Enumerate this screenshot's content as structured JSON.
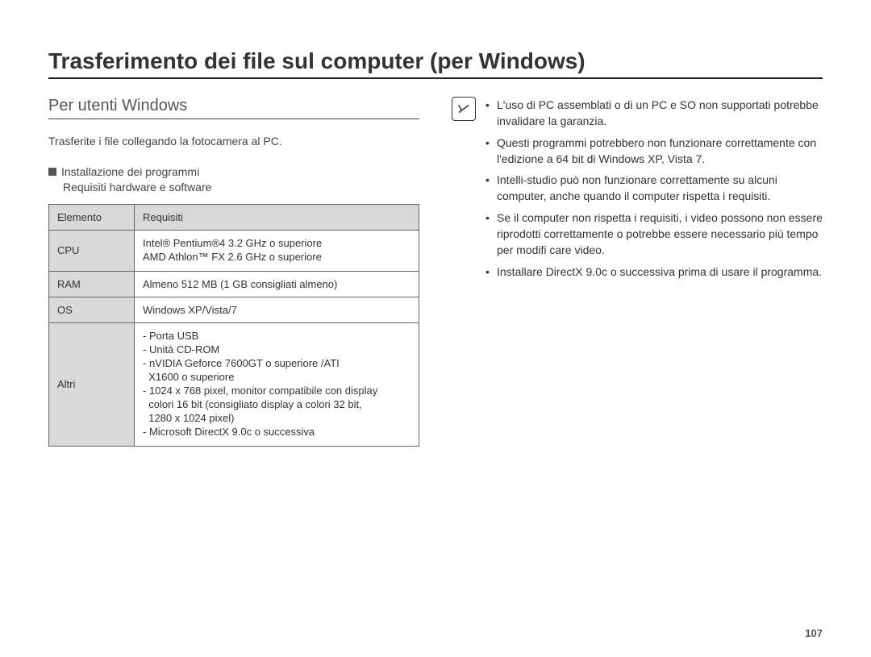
{
  "page_number": "107",
  "title": "Trasferimento dei file sul computer (per Windows)",
  "left": {
    "subtitle": "Per utenti Windows",
    "intro": "Trasferite i file collegando la fotocamera al PC.",
    "install_heading": "Installazione dei programmi",
    "install_sub": "Requisiti hardware e software",
    "table": {
      "header_element": "Elemento",
      "header_req": "Requisiti",
      "rows": {
        "cpu": {
          "label": "CPU",
          "l1": "Intel® Pentium®4 3.2 GHz o superiore",
          "l2": "AMD Athlon™ FX 2.6 GHz o superiore"
        },
        "ram": {
          "label": "RAM",
          "value": "Almeno 512 MB (1 GB consigliati almeno)"
        },
        "os": {
          "label": "OS",
          "value": "Windows XP/Vista/7"
        },
        "altri": {
          "label": "Altri",
          "l1": "- Porta USB",
          "l2": "- Unità CD-ROM",
          "l3": "- nVIDIA Geforce 7600GT o superiore /ATI",
          "l3b": "  X1600 o superiore",
          "l4": "- 1024 x 768 pixel, monitor compatibile con display",
          "l4b": "  colori 16 bit (consigliato display a colori 32 bit,",
          "l4c": "  1280 x 1024 pixel)",
          "l5": "- Microsoft DirectX 9.0c o successiva"
        }
      }
    }
  },
  "notes": {
    "n1": "L'uso di PC assemblati o di un PC e SO non supportati potrebbe invalidare la garanzia.",
    "n2": "Questi programmi potrebbero non funzionare correttamente con l'edizione a 64 bit di Windows XP, Vista 7.",
    "n3": "Intelli-studio può non funzionare correttamente su alcuni computer, anche quando il computer rispetta i requisiti.",
    "n4": "Se il computer non rispetta i requisiti, i video possono non essere riprodotti correttamente o potrebbe essere necessario più tempo per modifi care video.",
    "n5": "Installare DirectX 9.0c o successiva prima di usare il programma."
  }
}
